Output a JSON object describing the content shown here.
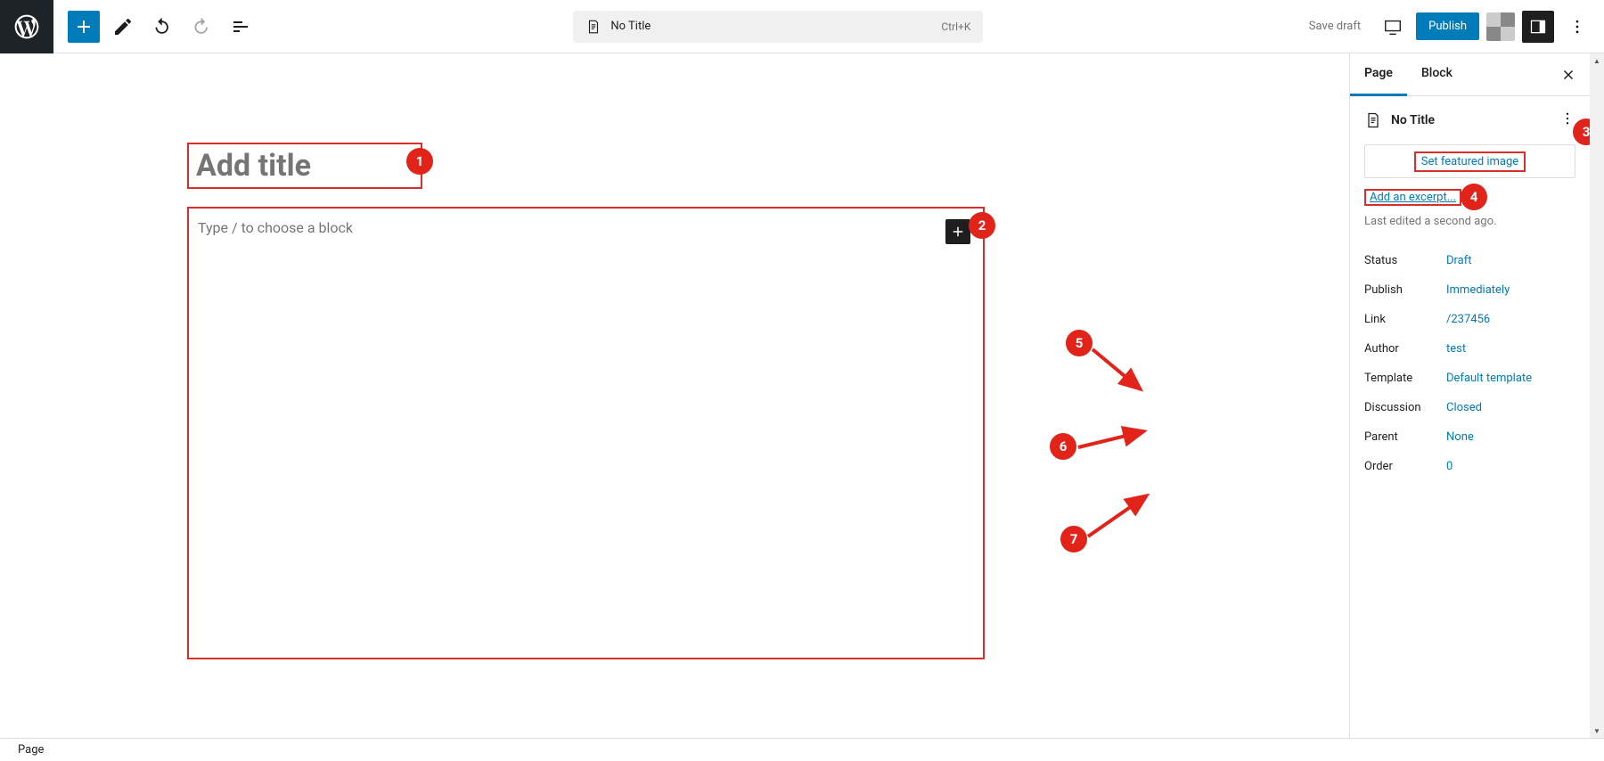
{
  "topbar": {
    "doc_title": "No Title",
    "shortcut": "Ctrl+K",
    "save_draft": "Save draft",
    "publish": "Publish"
  },
  "editor": {
    "title_placeholder": "Add title",
    "block_placeholder": "Type / to choose a block"
  },
  "sidebar": {
    "tabs": {
      "page": "Page",
      "block": "Block"
    },
    "doc_title": "No Title",
    "featured_label": "Set featured image",
    "excerpt_label": "Add an excerpt...",
    "last_edited": "Last edited a second ago.",
    "rows": [
      {
        "label": "Status",
        "value": "Draft"
      },
      {
        "label": "Publish",
        "value": "Immediately"
      },
      {
        "label": "Link",
        "value": "/237456"
      },
      {
        "label": "Author",
        "value": "test"
      },
      {
        "label": "Template",
        "value": "Default template"
      },
      {
        "label": "Discussion",
        "value": "Closed"
      },
      {
        "label": "Parent",
        "value": "None"
      },
      {
        "label": "Order",
        "value": "0"
      }
    ]
  },
  "footer": {
    "breadcrumb": "Page"
  },
  "annotations": {
    "c1": "1",
    "c2": "2",
    "c3": "3",
    "c4": "4",
    "c5": "5",
    "c6": "6",
    "c7": "7"
  }
}
